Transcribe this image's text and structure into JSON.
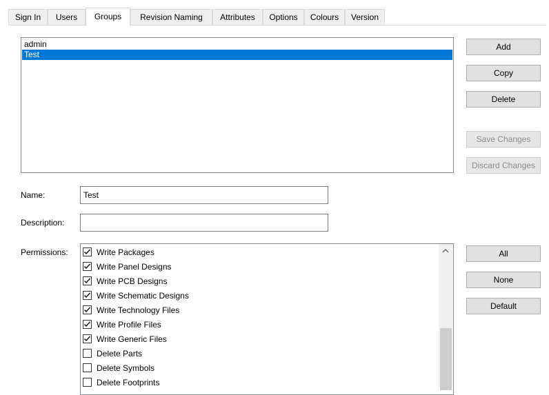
{
  "tabs": [
    "Sign In",
    "Users",
    "Groups",
    "Revision Naming",
    "Attributes",
    "Options",
    "Colours",
    "Version"
  ],
  "active_tab": "Groups",
  "groups": [
    "admin",
    "Test"
  ],
  "selected_group": "Test",
  "buttons": {
    "add": "Add",
    "copy": "Copy",
    "delete": "Delete",
    "save": "Save Changes",
    "discard": "Discard Changes",
    "all": "All",
    "none": "None",
    "default": "Default"
  },
  "form": {
    "name_label": "Name:",
    "name_value": "Test",
    "description_label": "Description:",
    "description_value": "",
    "permissions_label": "Permissions:"
  },
  "permissions": [
    {
      "label": "Write Packages",
      "checked": true
    },
    {
      "label": "Write Panel Designs",
      "checked": true
    },
    {
      "label": "Write PCB Designs",
      "checked": true
    },
    {
      "label": "Write Schematic Designs",
      "checked": true
    },
    {
      "label": "Write Technology Files",
      "checked": true
    },
    {
      "label": "Write Profile Files",
      "checked": true
    },
    {
      "label": "Write Generic Files",
      "checked": true
    },
    {
      "label": "Delete Parts",
      "checked": false
    },
    {
      "label": "Delete Symbols",
      "checked": false
    },
    {
      "label": "Delete Footprints",
      "checked": false
    }
  ],
  "colors": {
    "selection": "#0078d7",
    "button_face": "#e1e1e1",
    "disabled_text": "#8c8c8c"
  }
}
